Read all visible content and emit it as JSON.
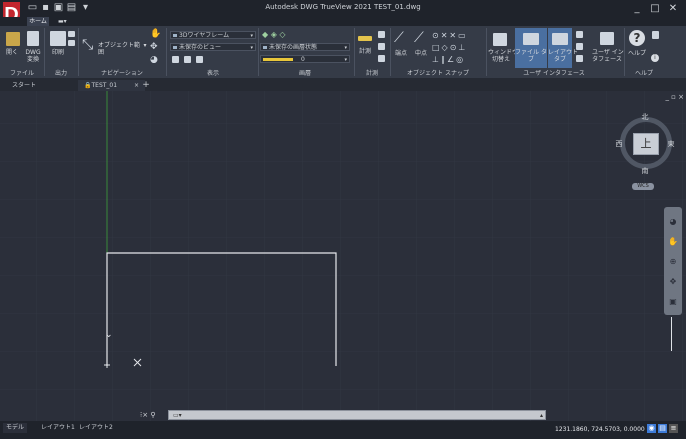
{
  "app": {
    "title": "Autodesk DWG TrueView 2021   TEST_01.dwg",
    "logo_letter": "D",
    "window_controls": {
      "minimize": "_",
      "maximize": "□",
      "close": "✕"
    }
  },
  "quick_access": [
    "open-icon",
    "save-icon",
    "print-icon",
    "plot-icon",
    "customize-icon"
  ],
  "ribbon_tabs": [
    {
      "label": "ホーム"
    },
    {
      "label": "▬▾"
    }
  ],
  "ribbon": {
    "panels": {
      "file": {
        "label": "ファイル",
        "open": "開く",
        "dwg_convert": "DWG\n変換"
      },
      "output": {
        "label": "出力",
        "plot": "印刷"
      },
      "navigation": {
        "label": "ナビゲーション",
        "extents": "オブジェクト範囲",
        "extents_arrow": "▾"
      },
      "view": {
        "label": "表示",
        "visual_style": "3Dワイヤフレーム",
        "named_view": "未保存のビュー"
      },
      "layers": {
        "label": "画層",
        "layer_state": "未保存の画層状態",
        "layer_current": "0"
      },
      "measure": {
        "label": "計測",
        "measure_btn": "計測"
      },
      "osnap": {
        "label": "オブジェクト スナップ",
        "endpoint": "端点",
        "midpoint": "中点"
      },
      "ui": {
        "label": "ユーザ インタフェース",
        "switch_window": "ウィンドウ\n切替え",
        "file_tab": "ファイル タブ",
        "layout_tab": "レイアウト\nタブ",
        "user_interface": "ユーザ イン\nタフェース"
      },
      "help": {
        "label": "ヘルプ",
        "help_btn": "ヘルプ"
      }
    }
  },
  "doc_tabs": [
    {
      "label": "スタート"
    },
    {
      "label": "TEST_01"
    },
    {
      "label": "+"
    }
  ],
  "doc_tab_close": "×",
  "view_controls": "_ ▫ ×",
  "viewcube": {
    "face": "上",
    "north": "北",
    "south": "南",
    "east": "東",
    "west": "西",
    "wcs": "WCS"
  },
  "layout_tabs": [
    {
      "label": "モデル"
    },
    {
      "label": "レイアウト1"
    },
    {
      "label": "レイアウト2"
    }
  ],
  "command_line": {
    "icons": "⁝× ⚲",
    "prompt": "▭▾",
    "scroll": "▴"
  },
  "status": {
    "coordinates": "1231.1860, 724.5703, 0.0000"
  }
}
